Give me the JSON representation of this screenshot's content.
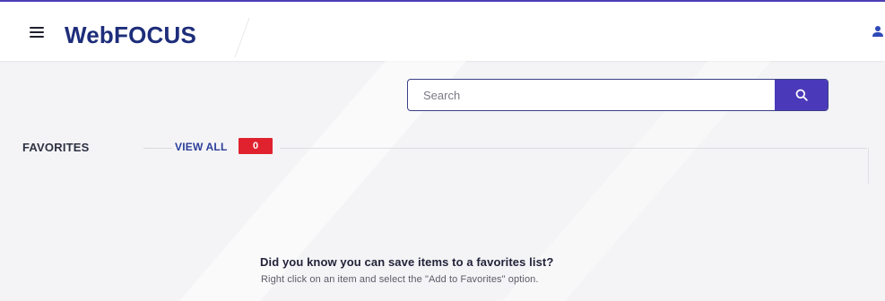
{
  "app": {
    "title": "WebFOCUS",
    "accent_color": "#4b3fb5",
    "brand_color": "#1d2d7a"
  },
  "header": {
    "menu_icon": "hamburger-menu-icon",
    "user_icon": "user-icon"
  },
  "search": {
    "placeholder": "Search",
    "value": "",
    "button_icon": "search-icon",
    "button_color": "#4a3aba"
  },
  "favorites": {
    "title": "FAVORITES",
    "view_all_label": "VIEW ALL",
    "count": "0",
    "badge_color": "#e0222e"
  },
  "empty_state": {
    "title": "Did you know you can save items to a favorites list?",
    "text": "Right click on an item and select the \"Add to Favorites\" option."
  }
}
